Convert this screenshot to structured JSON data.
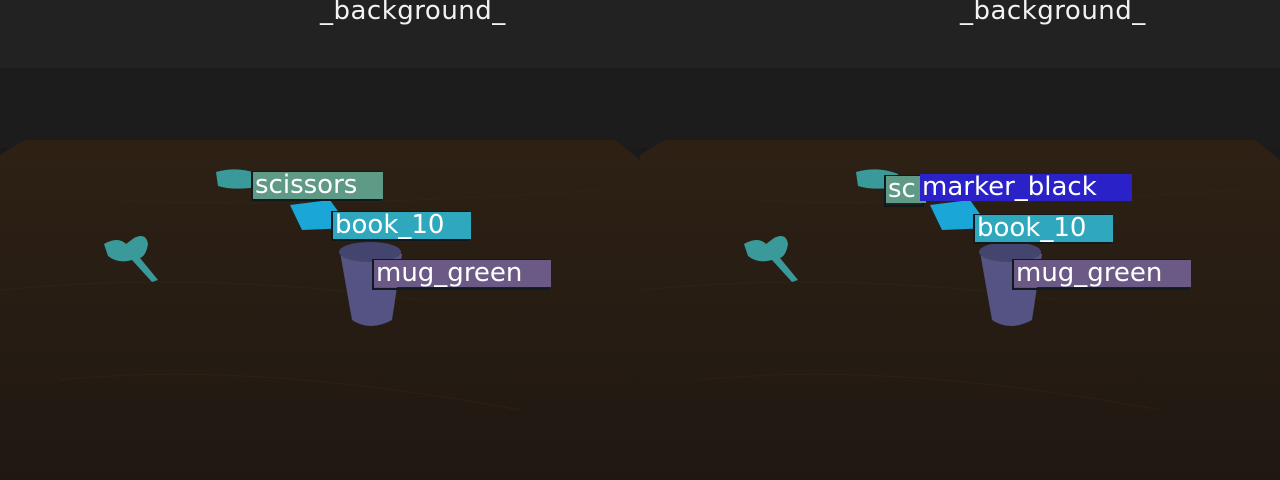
{
  "panels": [
    {
      "background_label": "_background_",
      "objects": [
        {
          "label": "scissors",
          "color": "#5f9a86"
        },
        {
          "label": "book_10",
          "color": "#2fa7bd"
        },
        {
          "label": "mug_green",
          "color": "#6b5a86"
        }
      ]
    },
    {
      "background_label": "_background_",
      "objects": [
        {
          "label": "sc",
          "color": "#5f9a86"
        },
        {
          "label": "marker_black",
          "color": "#2a22c8"
        },
        {
          "label": "book_10",
          "color": "#2fa7bd"
        },
        {
          "label": "mug_green",
          "color": "#6b5a86"
        }
      ]
    }
  ]
}
